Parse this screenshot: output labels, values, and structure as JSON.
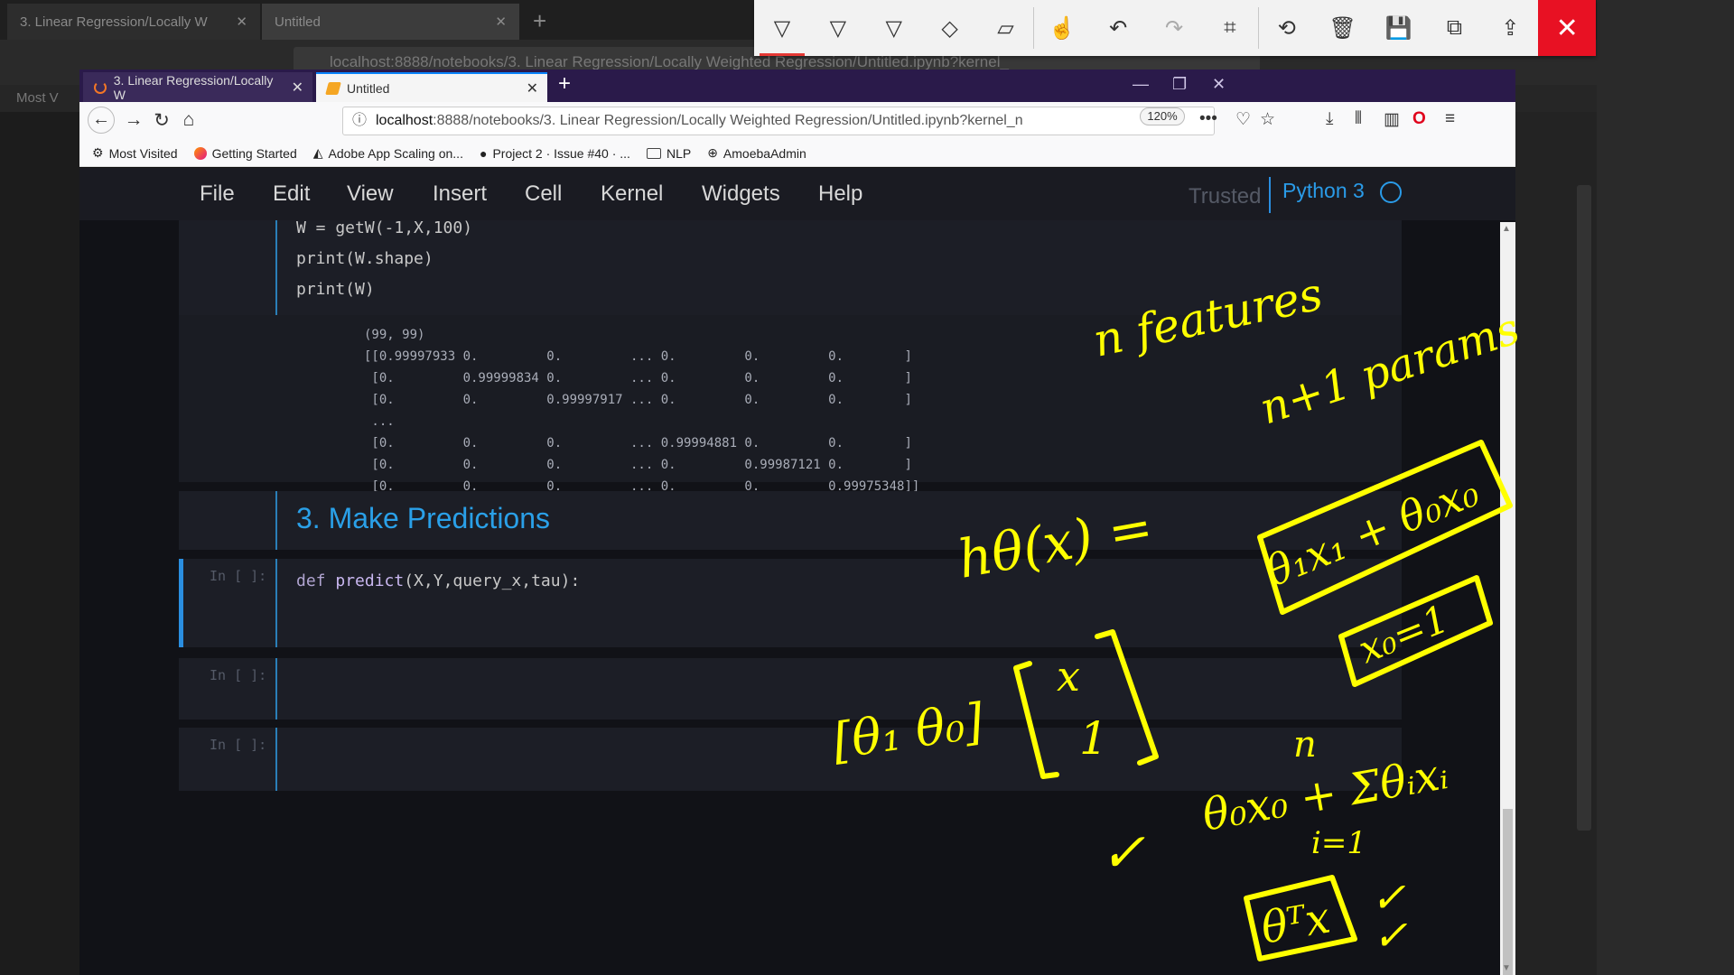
{
  "background_browser": {
    "tabs": [
      {
        "label": "3. Linear Regression/Locally W"
      },
      {
        "label": "Untitled"
      }
    ],
    "url": "localhost:8888/notebooks/3. Linear Regression/Locally Weighted Regression/Untitled.ipynb?kernel_",
    "zoom": "120%",
    "bookmark_first": "Most V"
  },
  "annotation_toolbar": {
    "tools": [
      {
        "name": "pen-yellow",
        "glyph": "▽"
      },
      {
        "name": "pen-orange",
        "glyph": "▽"
      },
      {
        "name": "highlighter",
        "glyph": "▽"
      },
      {
        "name": "eraser",
        "glyph": "◇"
      },
      {
        "name": "ruler",
        "glyph": "▱"
      },
      {
        "name": "touch",
        "glyph": "☝"
      },
      {
        "name": "undo",
        "glyph": "↶"
      },
      {
        "name": "redo",
        "glyph": "↷"
      },
      {
        "name": "crop",
        "glyph": "⌗"
      },
      {
        "name": "history",
        "glyph": "⟲"
      },
      {
        "name": "delete",
        "glyph": "🗑"
      },
      {
        "name": "save",
        "glyph": "💾"
      },
      {
        "name": "copy",
        "glyph": "⧉"
      },
      {
        "name": "share",
        "glyph": "⇪"
      }
    ],
    "close": "✕"
  },
  "browser": {
    "tabs": [
      {
        "label": "3. Linear Regression/Locally W"
      },
      {
        "label": "Untitled"
      }
    ],
    "new_tab": "+",
    "url_host": "localhost",
    "url_rest": ":8888/notebooks/3. Linear Regression/Locally Weighted Regression/Untitled.ipynb?kernel_n",
    "zoom": "120%",
    "bookmarks": [
      {
        "label": "Most Visited",
        "icon": "gear-icon"
      },
      {
        "label": "Getting Started",
        "icon": "firefox-icon"
      },
      {
        "label": "Adobe App Scaling on...",
        "icon": "adobe-icon"
      },
      {
        "label": "Project 2 · Issue #40 · ...",
        "icon": "github-icon"
      },
      {
        "label": "NLP",
        "icon": "folder-icon"
      },
      {
        "label": "AmoebaAdmin",
        "icon": "globe-icon"
      }
    ]
  },
  "jupyter": {
    "menu": [
      "File",
      "Edit",
      "View",
      "Insert",
      "Cell",
      "Kernel",
      "Widgets",
      "Help"
    ],
    "trusted": "Trusted",
    "kernel": "Python 3",
    "cells": {
      "code_top": [
        "W = getW(-1,X,100)",
        "print(W.shape)",
        "print(W)"
      ],
      "output": [
        "(99, 99)",
        "[[0.99997933 0.         0.         ... 0.         0.         0.        ]",
        " [0.         0.99999834 0.         ... 0.         0.         0.        ]",
        " [0.         0.         0.99997917 ... 0.         0.         0.        ]",
        " ...",
        " [0.         0.         0.         ... 0.99994881 0.         0.        ]",
        " [0.         0.         0.         ... 0.         0.99987121 0.        ]",
        " [0.         0.         0.         ... 0.         0.         0.99975348]]"
      ],
      "heading": "3. Make Predictions",
      "predict_prompt": "In [ ]:",
      "predict_code_kw": "def",
      "predict_code_fn": "predict",
      "predict_code_args": "(X,Y,query_x,tau):",
      "empty_prompt_1": "In [ ]:",
      "empty_prompt_2": "In [ ]:"
    }
  },
  "handwriting": {
    "n_features": "n features",
    "n_plus_1_params": "n+1 params",
    "hypothesis": "hθ(x) =",
    "boxed_sum": "θ₁x₁ + θ₀x₀",
    "x0_eq_1": "x₀=1",
    "theta_vec": "[θ₁  θ₀]",
    "col_vec_top": "x",
    "col_vec_bottom": "1",
    "sum_n": "n",
    "sum_expr": "θ₀x₀ + Σθᵢxᵢ",
    "sum_lower": "i=1",
    "theta_t_x": "θᵀx",
    "check": "✓"
  }
}
